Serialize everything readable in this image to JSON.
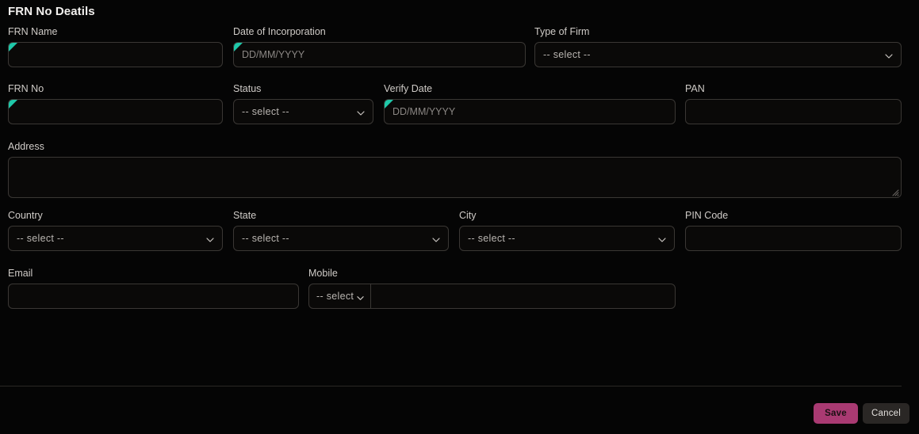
{
  "panel": {
    "title": "FRN No Deatils"
  },
  "placeholders": {
    "date": "DD/MM/YYYY",
    "select": "-- select --",
    "select_short": "-- select",
    "empty": ""
  },
  "rows": [
    {
      "fields": [
        {
          "label": "FRN Name",
          "type": "text",
          "value": "",
          "placeholder": "",
          "required": true
        },
        {
          "label": "Date of Incorporation",
          "type": "text",
          "value": "",
          "placeholder": "DD/MM/YYYY",
          "required": true
        },
        {
          "label": "Type of Firm",
          "type": "select",
          "value": "-- select --",
          "required": false
        }
      ]
    },
    {
      "fields": [
        {
          "label": "FRN No",
          "type": "text",
          "value": "",
          "placeholder": "",
          "required": true
        },
        {
          "label": "Status",
          "type": "select",
          "value": "-- select --",
          "required": false
        },
        {
          "label": "Verify Date",
          "type": "text",
          "value": "",
          "placeholder": "DD/MM/YYYY",
          "required": true
        },
        {
          "label": "PAN",
          "type": "text",
          "value": "",
          "placeholder": "",
          "required": false
        }
      ]
    },
    {
      "fields": [
        {
          "label": "Address",
          "type": "textarea",
          "value": "",
          "placeholder": "",
          "required": false
        }
      ]
    },
    {
      "fields": [
        {
          "label": "Country",
          "type": "select",
          "value": "-- select --",
          "required": false
        },
        {
          "label": "State",
          "type": "select",
          "value": "-- select --",
          "required": false
        },
        {
          "label": "City",
          "type": "select",
          "value": "-- select --",
          "required": false
        },
        {
          "label": "PIN Code",
          "type": "text",
          "value": "",
          "placeholder": "",
          "required": false
        }
      ]
    },
    {
      "fields": [
        {
          "label": "Email",
          "type": "text",
          "value": "",
          "placeholder": "",
          "required": false
        },
        {
          "label": "Mobile",
          "type": "phone",
          "code_value": "-- select",
          "value": "",
          "placeholder": "",
          "required": false
        }
      ]
    }
  ],
  "footer": {
    "save_label": "Save",
    "cancel_label": "Cancel"
  },
  "colors": {
    "accent_required": "#1fc8a9",
    "save_button": "#a93a72",
    "cancel_button": "#2a2725",
    "panel_background": "#050505",
    "field_border": "#3a3734"
  },
  "icons": {
    "chevron": "chevron-down-icon",
    "resize": "resize-handle-icon"
  }
}
